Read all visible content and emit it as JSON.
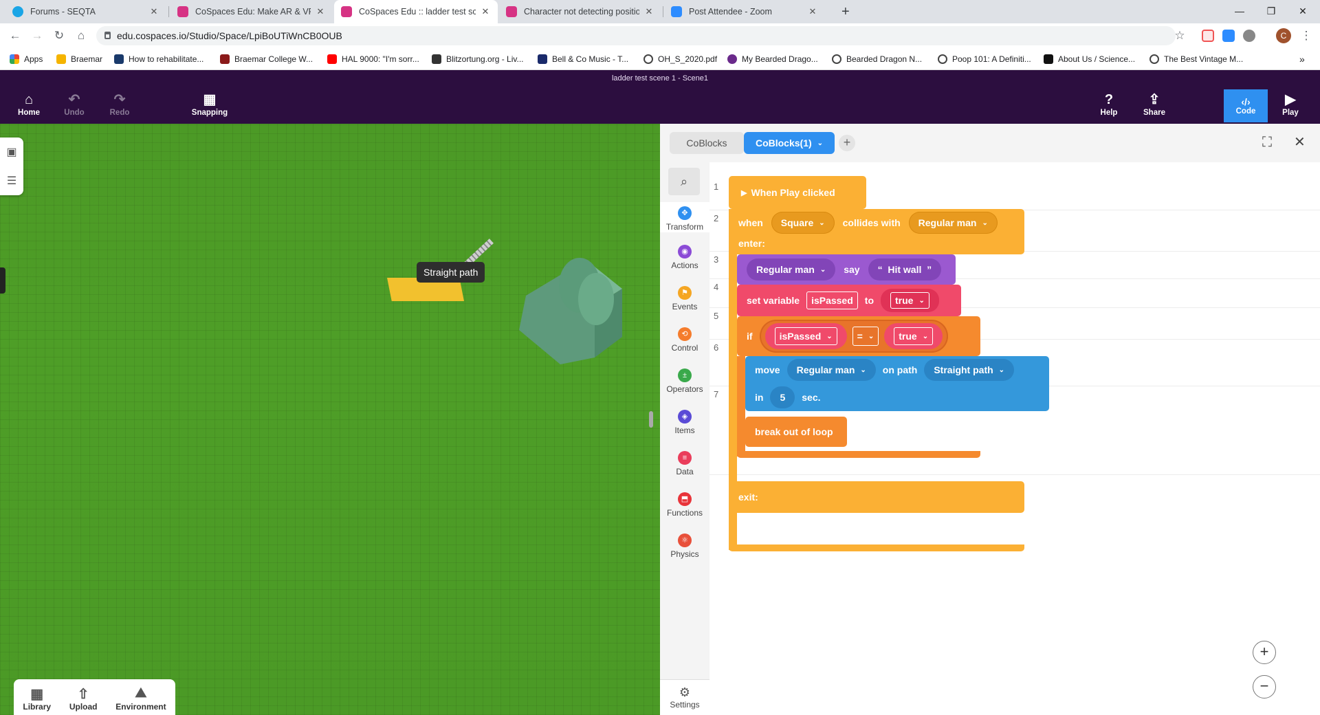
{
  "browser": {
    "tabs": [
      {
        "title": "Forums - SEQTA",
        "color": "#1aa5e6"
      },
      {
        "title": "CoSpaces Edu: Make AR & VR in",
        "color": "#d63384"
      },
      {
        "title": "CoSpaces Edu :: ladder test scene",
        "color": "#d63384"
      },
      {
        "title": "Character not detecting position",
        "color": "#d63384"
      },
      {
        "title": "Post Attendee - Zoom",
        "color": "#2d8cff"
      }
    ],
    "url": "edu.cospaces.io/Studio/Space/LpiBoUTiWnCB0OUB",
    "bookmarks": [
      "Apps",
      "Braemar",
      "How to rehabilitate...",
      "Braemar College W...",
      "HAL 9000: \"I'm sorr...",
      "Blitzortung.org - Liv...",
      "Bell & Co Music - T...",
      "OH_S_2020.pdf",
      "My Bearded Drago...",
      "Bearded Dragon N...",
      "Poop 101: A Definiti...",
      "About Us / Science...",
      "The Best Vintage M..."
    ],
    "profile_initial": "C"
  },
  "app": {
    "scene_title": "ladder test scene 1 - Scene1",
    "home": "Home",
    "undo": "Undo",
    "redo": "Redo",
    "snapping": "Snapping",
    "help": "Help",
    "share": "Share",
    "code": "Code",
    "play": "Play"
  },
  "scene": {
    "tooltip": "Straight path",
    "library": "Library",
    "upload": "Upload",
    "environment": "Environment"
  },
  "code": {
    "tabs": [
      "CoBlocks",
      "CoBlocks(1)"
    ],
    "add_tab": "+",
    "categories": [
      {
        "label": "Transform",
        "color": "#2f90f0"
      },
      {
        "label": "Actions",
        "color": "#8b4bd6"
      },
      {
        "label": "Events",
        "color": "#f5a623"
      },
      {
        "label": "Control",
        "color": "#f57c2c"
      },
      {
        "label": "Operators",
        "color": "#3aa94b"
      },
      {
        "label": "Items",
        "color": "#5a4bd6"
      },
      {
        "label": "Data",
        "color": "#ea3d5b"
      },
      {
        "label": "Functions",
        "color": "#e8343a"
      },
      {
        "label": "Physics",
        "color": "#e8503a"
      }
    ],
    "settings": "Settings",
    "line_numbers": [
      "1",
      "2",
      "3",
      "4",
      "5",
      "6",
      "7"
    ],
    "blocks": {
      "when_play": "When Play clicked",
      "when": "when",
      "collider_a": "Square",
      "collides_with": "collides with",
      "collider_b": "Regular man",
      "enter": "enter:",
      "say_item": "Regular man",
      "say": "say",
      "say_text": "Hit wall",
      "set_variable": "set variable",
      "var_name": "isPassed",
      "to": "to",
      "var_value": "true",
      "if": "if",
      "cond_var": "isPassed",
      "cond_op": "=",
      "cond_value": "true",
      "move": "move",
      "move_item": "Regular man",
      "on_path": "on path",
      "path_name": "Straight path",
      "in": "in",
      "seconds": "5",
      "sec": "sec.",
      "break": "break out of loop",
      "exit": "exit:"
    },
    "zoom_in": "+",
    "zoom_out": "−"
  }
}
